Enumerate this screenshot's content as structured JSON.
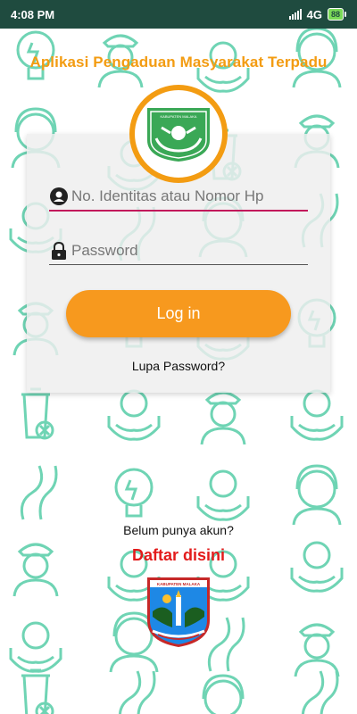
{
  "status_bar": {
    "time": "4:08 PM",
    "network": "4G",
    "battery": "88"
  },
  "app": {
    "title": "Aplikasi Pengaduan Masyarakat Terpadu"
  },
  "form": {
    "identity_placeholder": "No. Identitas atau Nomor Hp",
    "password_placeholder": "Password",
    "login_label": "Log in",
    "forgot_label": "Lupa Password?"
  },
  "footer": {
    "no_account_label": "Belum punya akun?",
    "register_label": "Daftar disini"
  },
  "colors": {
    "accent": "#f7991e",
    "title": "#f39c12",
    "status_bar": "#1f4b3f",
    "pattern": "#6fd4b4",
    "register": "#e31b1b"
  },
  "logo_texts": {
    "app_logo": "KABUPATEN MALAKA",
    "district_logo": "KABUPATEN MALAKA"
  }
}
